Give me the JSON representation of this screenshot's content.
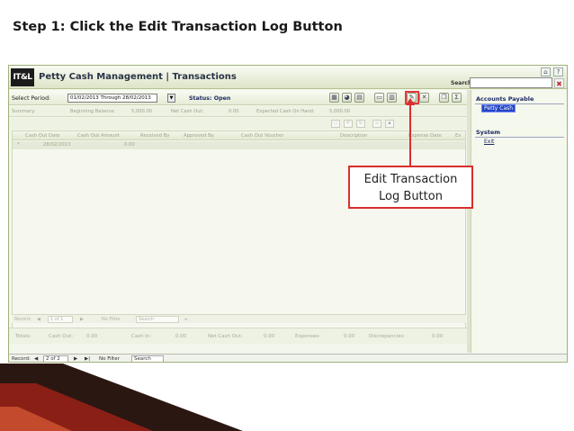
{
  "slide": {
    "title": "Step 1: Click the Edit Transaction Log Button"
  },
  "app": {
    "logo_text": "IT&L",
    "title": "Petty Cash Management | Transactions",
    "search_label": "Search:",
    "search_value": ""
  },
  "toolbar": {
    "period_label": "Select Period:",
    "period_value": "01/02/2013 Through 28/02/2013",
    "status_label": "Status:",
    "status_value": "Open"
  },
  "summary": {
    "label": "Summary:",
    "beginning_balance_label": "Beginning Balance:",
    "beginning_balance_value": "5,000.00",
    "net_cash_out_label": "Net Cash Out:",
    "net_cash_out_value": "0.00",
    "expected_cash_label": "Expected Cash On Hand:",
    "expected_cash_value": "5,000.00"
  },
  "grid": {
    "columns": [
      "Cash Out Date",
      "Cash Out Amount",
      "Received By",
      "Approved By",
      "Cash Out Voucher",
      "Description",
      "Expense Date",
      "Ex"
    ],
    "rows": [
      {
        "marker": "*",
        "date": "28/02/2013",
        "amount": "0.00"
      }
    ]
  },
  "inner_nav": {
    "record_label": "Record:",
    "position": "1 of 1",
    "filter_label": "No Filter",
    "search_placeholder": "Search"
  },
  "totals": {
    "label": "Totals:",
    "cash_out_label": "Cash Out:",
    "cash_out_value": "0.00",
    "cash_in_label": "Cash In:",
    "cash_in_value": "0.00",
    "net_cash_out_label": "Net Cash Out:",
    "net_cash_out_value": "0.00",
    "expenses_label": "Expenses:",
    "expenses_value": "0.00",
    "discrepancies_label": "Discrepancies:",
    "discrepancies_value": "0.00"
  },
  "record_nav": {
    "record_label": "Record:",
    "position": "2 of 2",
    "filter_label": "No Filter",
    "search_placeholder": "Search"
  },
  "right_panel": {
    "section1": "Accounts Payable",
    "item1": "Petty Cash",
    "section2": "System",
    "item2": "Exit"
  },
  "callout": {
    "line1": "Edit Transaction",
    "line2": "Log Button"
  },
  "colors": {
    "highlight": "#d92e2e",
    "selected_item": "#2345c2",
    "header_text": "#1d2a63",
    "banner_dark": "#2b1712",
    "banner_red": "#8a1f16"
  },
  "icons": [
    "calendar-icon",
    "pie-chart-icon",
    "report-icon",
    "print-icon",
    "chart-icon",
    "pencil-icon",
    "delete-icon",
    "copy-icon",
    "sum-icon",
    "home-icon",
    "help-icon"
  ]
}
